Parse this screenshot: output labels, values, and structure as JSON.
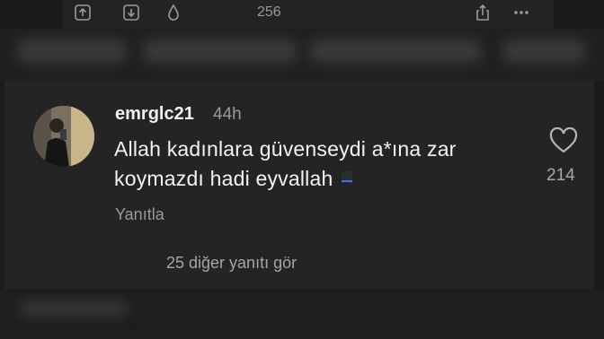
{
  "toolbar": {
    "drop_count": "256",
    "icons": [
      "upload-icon",
      "download-icon",
      "drop-icon",
      "share-icon",
      "more-icon"
    ]
  },
  "comment": {
    "username": "emrglc21",
    "time": "44h",
    "text": "Allah kadınlara güvenseydi a*ına zar koymazdı hadi eyvallah",
    "reply_label": "Yanıtla",
    "more_replies_label": "25 diğer yanıtı gör",
    "like_count": "214"
  },
  "colors": {
    "background": "#1b1b1b",
    "card": "#242424",
    "muted_text": "#9a9a9a"
  }
}
